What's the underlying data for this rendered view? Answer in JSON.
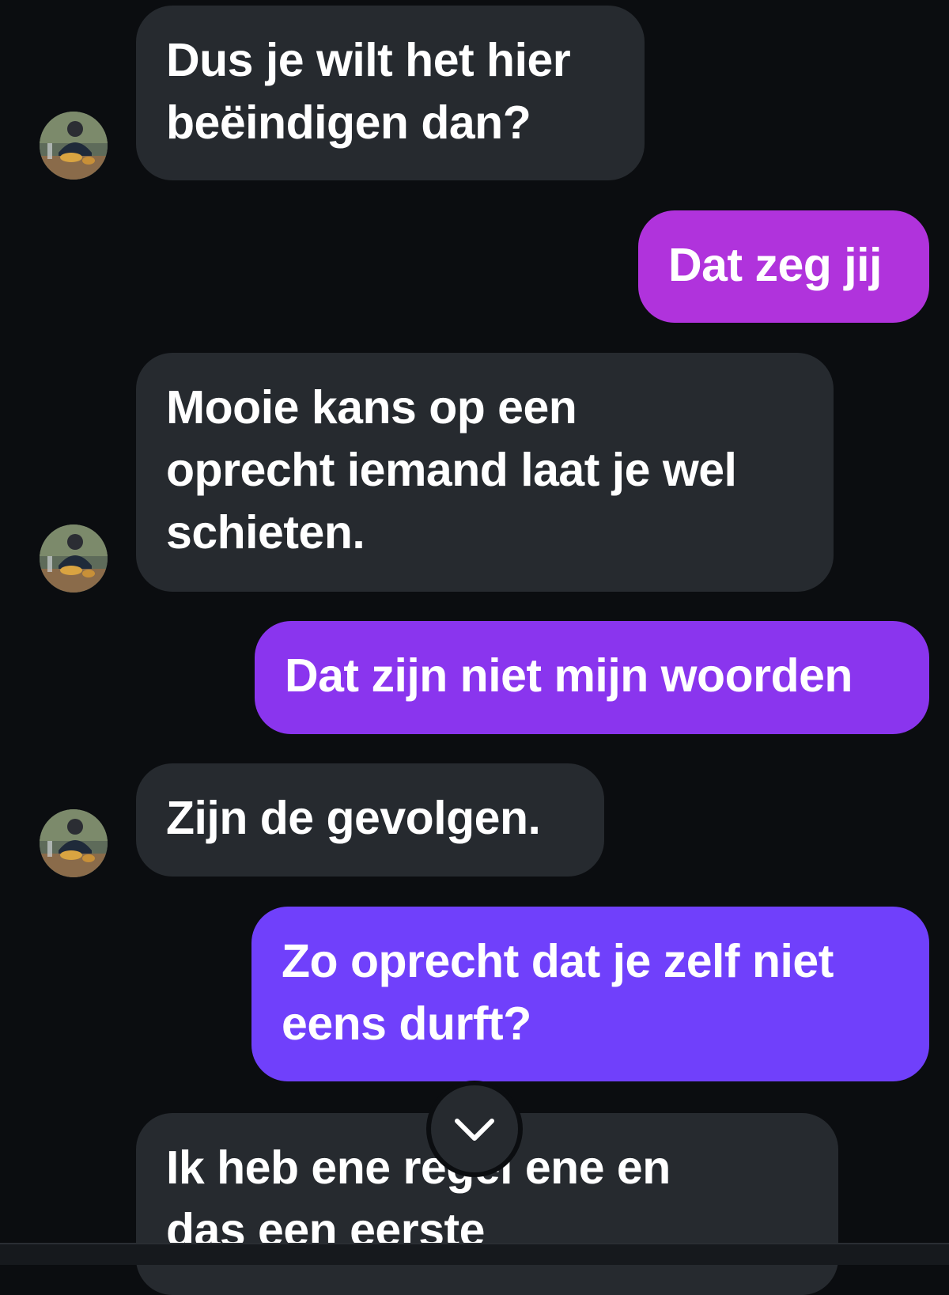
{
  "colors": {
    "background": "#0b0d10",
    "incoming_bubble": "#262a2f",
    "outgoing_top": "#b033dc",
    "outgoing_mid": "#8a35ee",
    "outgoing_bottom": "#7040fb",
    "text": "#ffffff"
  },
  "messages": [
    {
      "direction": "incoming",
      "text": "Dus je wilt het hier\nbeëindigen dan?"
    },
    {
      "direction": "outgoing",
      "text": "Dat zeg jij"
    },
    {
      "direction": "incoming",
      "text": "Mooie kans op een\noprecht iemand laat je wel\nschieten."
    },
    {
      "direction": "outgoing",
      "text": "Dat zijn niet mijn woorden"
    },
    {
      "direction": "incoming",
      "text": "Zijn de gevolgen."
    },
    {
      "direction": "outgoing",
      "text": "Zo oprecht dat je zelf niet\neens durft?"
    },
    {
      "direction": "incoming",
      "text": "Ik heb ene regel ene en\ndas een eerste"
    }
  ],
  "scroll_button": {
    "icon": "chevron-down-icon"
  },
  "avatar": {
    "icon": "contact-avatar-photo"
  }
}
